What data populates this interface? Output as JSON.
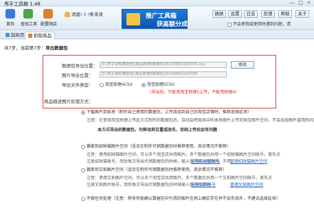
{
  "window": {
    "title": "甩手工具箱 1.48",
    "controls": [
      "—",
      "□",
      "✕"
    ]
  },
  "toolbar": {
    "buttons": [
      {
        "label": "首页",
        "color": "#3a7bd5"
      },
      {
        "label": "查找工具",
        "color": "#4aa84a"
      },
      {
        "label": "配置网店",
        "color": "#d9822b"
      }
    ],
    "notice_text": "消息",
    "notice_count": "( 0 )",
    "notice_suffix": "条未读",
    "banner_line1": "推广工具箱",
    "banner_line2": "获高额分成",
    "right_buttons": [
      "换肤",
      "设置",
      "日志",
      "反馈",
      "帮助",
      "关于"
    ],
    "sub_note": "不会使用或使用时遇到问题，请"
  },
  "tabs": [
    {
      "label": "起始页",
      "active": false
    },
    {
      "label": "抓取商品",
      "active": true
    }
  ],
  "step": {
    "total": "共7步，当前第7步：",
    "current": "导出数据包"
  },
  "form": {
    "data_export_label": "数据包导出位置：",
    "data_export_path": "D:\\甩手掌柜数据包\\淘宝助理5数据包20140902100705.csv",
    "image_export_label": "图片导出位置：",
    "image_export_path": "D:\\甩手掌柜数据包\\淘宝助理5数据包20140902100705",
    "modify_button": "修改",
    "type_label": "导出文件类型：",
    "type_option1": "淘宝助理4CSV",
    "type_option2": "淘宝助理5CSV",
    "type_hint": "(导出后，只能用淘宝助理5上传，不能用助理4)",
    "image_mode_label": "商品描述图片处理方式："
  },
  "options": {
    "opt1_label": "下载图片到本地（制作自己使用的数据包，上传商品到自己的淘宝店铺时，推荐选择此项）",
    "opt1_note": "注意：在使用淘宝助理上传此方式制作的数据包后，自动会把商品中的本地图片上传到淘宝图片空间，不会出现图片盗用的问题。",
    "opt1_warning": "本方式导出的数据包，勿移动其位置或改名，否则上传后会有问题",
    "opt2_label": "搬家到招财猫图片空间（适合在制作代销数据包时推荐使用，其余情况不推荐）",
    "opt2_note1": "注意：使用招财猫图片空间，可以多个淘宝店共用图片，多个数据包共用一个招财猫图片空间账号，首先点",
    "opt2_note2": "注册招财猫账号，然后每次导出代销数据包的时候，输入账号名以及密码，不用",
    "opt2_link1": "注册招财猫账号",
    "opt2_link2": "管理招财猫图片空间",
    "opt3_label": "搬家到又拍图片空间（适合在制作代销数据包时推荐使用，其余情况不推荐）",
    "opt3_note1": "注意：使用又拍图片空间，可以多个淘宝店共用图片，多个数据包共用一个又拍图片空间账号，首先点",
    "opt3_note2": "注册又拍图片账号，然后每次导出代销数据包的时候输入账号及密码",
    "opt3_link1": "注册又拍账号",
    "opt3_link2": "管理又拍图片空间",
    "opt4_label": "不做任何处理（注意：除非你能确认数据包中引用的图片在网上确实存在并不会失效外，不建议选择此项）"
  }
}
